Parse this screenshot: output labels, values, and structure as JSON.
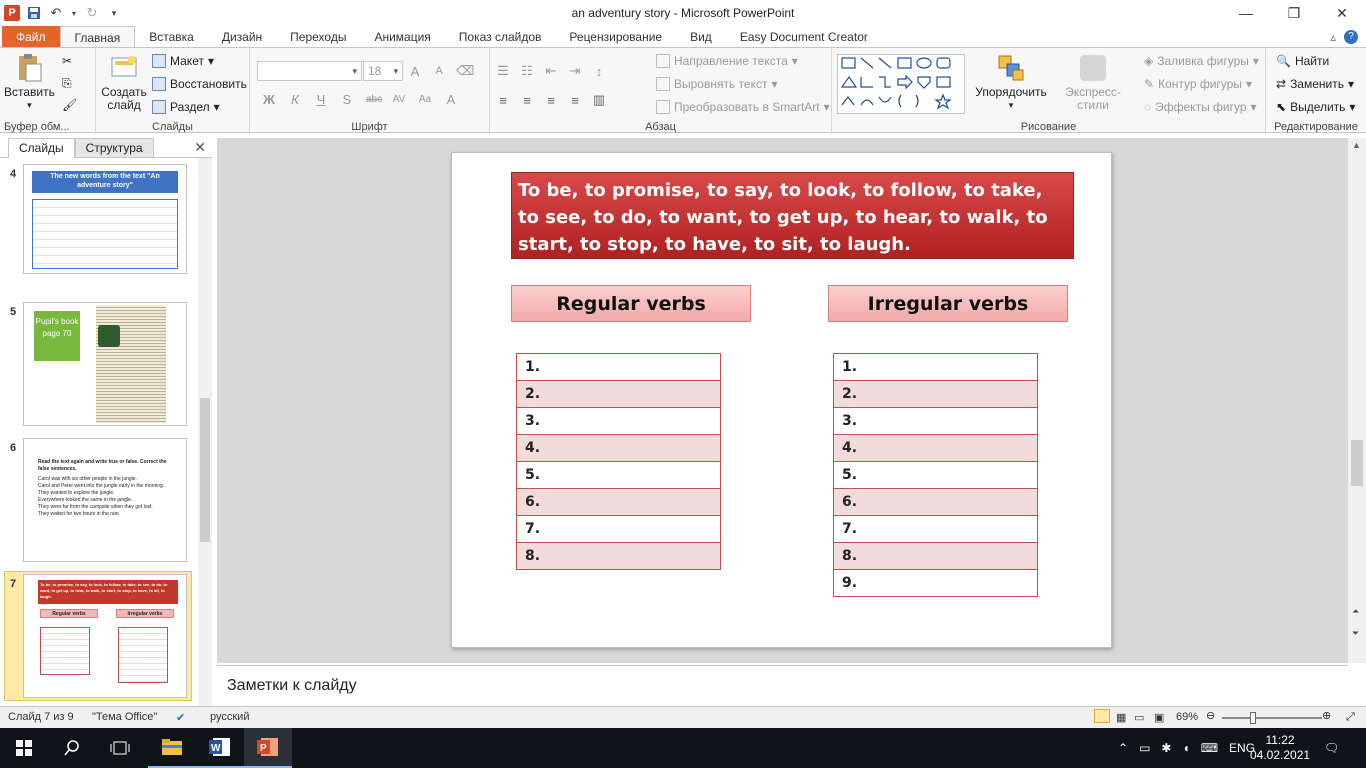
{
  "window": {
    "title": "an adventury story  -  Microsoft PowerPoint"
  },
  "ribbon_tabs": [
    "Файл",
    "Главная",
    "Вставка",
    "Дизайн",
    "Переходы",
    "Анимация",
    "Показ слайдов",
    "Рецензирование",
    "Вид",
    "Easy Document Creator"
  ],
  "ribbon": {
    "clipboard": {
      "paste": "Вставить",
      "label": "Буфер обм..."
    },
    "slides": {
      "new_slide": "Создать слайд",
      "layout": "Макет",
      "reset": "Восстановить",
      "section": "Раздел",
      "label": "Слайды"
    },
    "font": {
      "size": "18",
      "label": "Шрифт"
    },
    "paragraph": {
      "text_direction": "Направление текста",
      "align_text": "Выровнять текст",
      "smartart": "Преобразовать в SmartArt",
      "label": "Абзац"
    },
    "drawing": {
      "arrange": "Упорядочить",
      "quick_styles": "Экспресс-стили",
      "fill": "Заливка фигуры",
      "outline": "Контур фигуры",
      "effects": "Эффекты фигур",
      "label": "Рисование"
    },
    "editing": {
      "find": "Найти",
      "replace": "Заменить",
      "select": "Выделить",
      "label": "Редактирование"
    }
  },
  "left_panel": {
    "tab_slides": "Слайды",
    "tab_outline": "Структура",
    "thumbs": [
      {
        "num": "4",
        "title": "The new words from the text \"An adventure story\""
      },
      {
        "num": "5",
        "label": "Pupil's book page 70"
      },
      {
        "num": "6",
        "heading": "Read the text again and write true or false. Correct the false sentences.",
        "items": [
          "Carol was with six other people in the jungle.",
          "Carol and Peter went into the jungle early in the morning.",
          "They wanted to explore the jungle.",
          "Everywhere looked the same in the jungle.",
          "They were far from the campsite when they got lost.",
          "They waited for two hours in the rain."
        ]
      },
      {
        "num": "7",
        "text": "To be, to promise, to say, to look, to follow, to take, to see, to do, to want, to get up, to hear, to walk, to start, to stop, to have, to sit, to laugh.",
        "regular": "Regular verbs",
        "irregular": "Irregular verbs"
      }
    ]
  },
  "slide": {
    "verbs_text": "To be, to promise, to say, to look, to follow, to take, to see, to do, to want,  to get up, to hear,  to walk, to start, to stop, to have, to sit, to laugh.",
    "regular_header": "Regular verbs",
    "irregular_header": "Irregular verbs",
    "regular_rows": [
      "1.",
      "2.",
      "3.",
      "4.",
      "5.",
      "6.",
      "7.",
      "8."
    ],
    "irregular_rows": [
      "1.",
      "2.",
      "3.",
      "4.",
      "5.",
      "6.",
      "7.",
      "8.",
      "9."
    ]
  },
  "notes": {
    "placeholder": "Заметки к слайду"
  },
  "status": {
    "slide_info": "Слайд 7 из 9",
    "theme": "\"Тема Office\"",
    "language": "русский",
    "zoom": "69%"
  },
  "taskbar": {
    "lang": "ENG",
    "time": "11:22",
    "date": "04.02.2021"
  }
}
